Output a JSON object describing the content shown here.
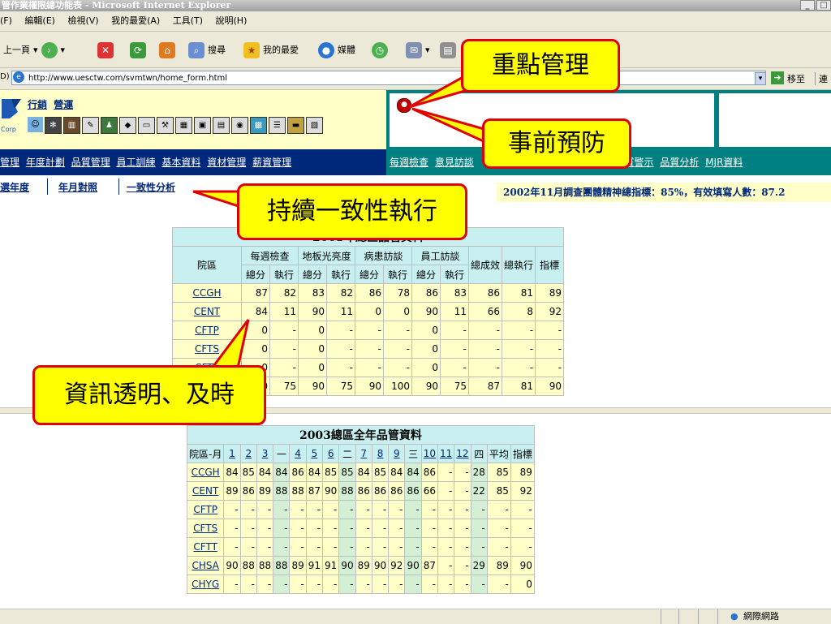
{
  "window": {
    "title": "管作業權限總功能表 - Microsoft Internet Explorer"
  },
  "menubar": [
    "(F)",
    "編輯(E)",
    "檢視(V)",
    "我的最愛(A)",
    "工具(T)",
    "說明(H)"
  ],
  "toolbar": {
    "back": "上一頁",
    "search": "搜尋",
    "favorites": "我的最愛",
    "media": "媒體"
  },
  "address": {
    "prefix": "D)",
    "url": "http://www.uesctw.com/svmtwn/home_form.html",
    "go": "移至",
    "links": "連"
  },
  "header": {
    "brand1": "行銷",
    "brand2": "營運",
    "corp": "Corp"
  },
  "nav_left": [
    "管理",
    "年度計劃",
    "品質管理",
    "員工訓練",
    "基本資料",
    "資材管理",
    "薪資管理"
  ],
  "nav_right": [
    "每週檢查",
    "意見訪談",
    "",
    "品質警示",
    "品質分析",
    "MJR資料"
  ],
  "tabs": [
    "選年度",
    "年月對照",
    "一致性分析"
  ],
  "banner": "2002年11月調查團體精神總指標：85%，有效填寫人數：87.2",
  "table1": {
    "title": "2003年總區品管資料",
    "col_site": "院區",
    "groups": [
      "每週檢查",
      "地板光亮度",
      "病患訪談",
      "員工訪談"
    ],
    "sub": [
      "總分",
      "執行"
    ],
    "tail": [
      "總成效",
      "總執行",
      "指標"
    ],
    "rows": [
      {
        "site": "CCGH",
        "vals": [
          "87",
          "82",
          "83",
          "82",
          "86",
          "78",
          "86",
          "83",
          "86",
          "81",
          "89"
        ]
      },
      {
        "site": "CENT",
        "vals": [
          "84",
          "11",
          "90",
          "11",
          "0",
          "0",
          "90",
          "11",
          "66",
          "8",
          "92"
        ]
      },
      {
        "site": "CFTP",
        "vals": [
          "0",
          "-",
          "0",
          "-",
          "-",
          "-",
          "0",
          "-",
          "-",
          "-",
          "-"
        ]
      },
      {
        "site": "CFTS",
        "vals": [
          "0",
          "-",
          "0",
          "-",
          "-",
          "-",
          "0",
          "-",
          "-",
          "-",
          "-"
        ]
      },
      {
        "site": "CFTT",
        "vals": [
          "0",
          "-",
          "0",
          "-",
          "-",
          "-",
          "0",
          "-",
          "-",
          "-",
          "-"
        ]
      },
      {
        "site": "CHSA",
        "vals": [
          "0",
          "75",
          "90",
          "75",
          "90",
          "100",
          "90",
          "75",
          "87",
          "81",
          "90"
        ]
      }
    ]
  },
  "table2": {
    "title": "2003總區全年品管資料",
    "col_site": "院區-月",
    "months": [
      "1",
      "2",
      "3",
      "一",
      "4",
      "5",
      "6",
      "二",
      "7",
      "8",
      "9",
      "三",
      "10",
      "11",
      "12",
      "四",
      "平均",
      "指標"
    ],
    "rows": [
      {
        "site": "CCGH",
        "vals": [
          "84",
          "85",
          "84",
          "84",
          "86",
          "84",
          "85",
          "85",
          "84",
          "85",
          "84",
          "84",
          "86",
          "-",
          "-",
          "28",
          "85",
          "89"
        ]
      },
      {
        "site": "CENT",
        "vals": [
          "89",
          "86",
          "89",
          "88",
          "88",
          "87",
          "90",
          "88",
          "86",
          "86",
          "86",
          "86",
          "66",
          "-",
          "-",
          "22",
          "85",
          "92"
        ]
      },
      {
        "site": "CFTP",
        "vals": [
          "-",
          "-",
          "-",
          "-",
          "-",
          "-",
          "-",
          "-",
          "-",
          "-",
          "-",
          "-",
          "-",
          "-",
          "-",
          "-",
          "-",
          "-"
        ]
      },
      {
        "site": "CFTS",
        "vals": [
          "-",
          "-",
          "-",
          "-",
          "-",
          "-",
          "-",
          "-",
          "-",
          "-",
          "-",
          "-",
          "-",
          "-",
          "-",
          "-",
          "-",
          "-"
        ]
      },
      {
        "site": "CFTT",
        "vals": [
          "-",
          "-",
          "-",
          "-",
          "-",
          "-",
          "-",
          "-",
          "-",
          "-",
          "-",
          "-",
          "-",
          "-",
          "-",
          "-",
          "-",
          "-"
        ]
      },
      {
        "site": "CHSA",
        "vals": [
          "90",
          "88",
          "88",
          "88",
          "89",
          "91",
          "91",
          "90",
          "89",
          "90",
          "92",
          "90",
          "87",
          "-",
          "-",
          "29",
          "89",
          "90"
        ]
      },
      {
        "site": "CHYG",
        "vals": [
          "-",
          "-",
          "-",
          "-",
          "-",
          "-",
          "-",
          "-",
          "-",
          "-",
          "-",
          "-",
          "-",
          "-",
          "-",
          "-",
          "-",
          "0"
        ]
      }
    ]
  },
  "statusbar": {
    "zone": "網際網路"
  },
  "callouts": {
    "c1": "重點管理",
    "c2": "事前預防",
    "c3": "持續一致性執行",
    "c4": "資訊透明、及時"
  }
}
